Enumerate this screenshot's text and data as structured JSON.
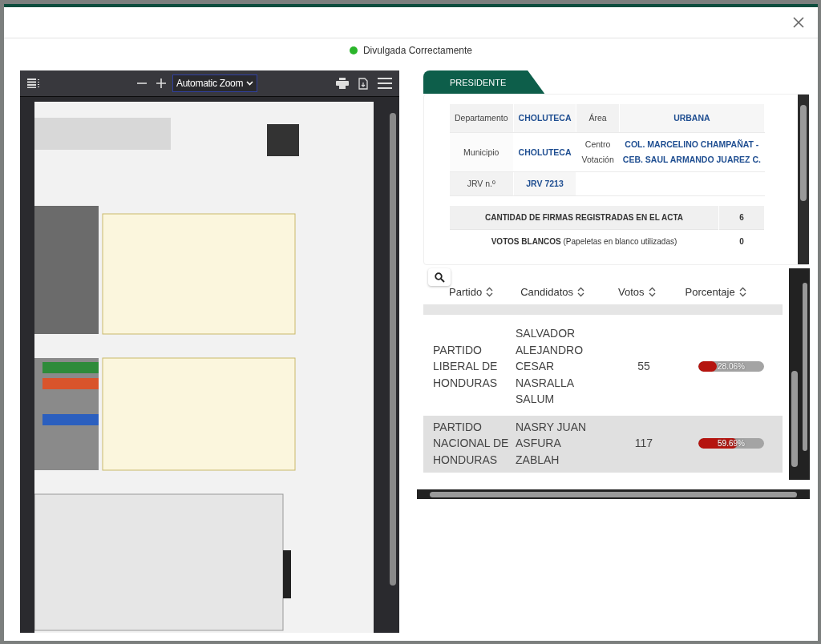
{
  "dialog": {
    "status": {
      "text": "Divulgada Correctamente",
      "color": "#2ab52a"
    }
  },
  "pdf_viewer": {
    "zoom": "Automatic Zoom"
  },
  "tabs": [
    {
      "label": "PRESIDENTE",
      "selected": true
    }
  ],
  "info_table": {
    "rows": [
      {
        "cells": [
          {
            "kind": "label",
            "text": "Departamento"
          },
          {
            "kind": "value",
            "text": "CHOLUTECA"
          },
          {
            "kind": "label",
            "text": "Área"
          },
          {
            "kind": "value",
            "text": "URBANA"
          }
        ]
      },
      {
        "cells": [
          {
            "kind": "label",
            "text": "Municipio"
          },
          {
            "kind": "value",
            "text": "CHOLUTECA"
          },
          {
            "kind": "label",
            "text": "Centro Votación"
          },
          {
            "kind": "value",
            "text": "COL. MARCELINO CHAMPAÑAT - CEB. SAUL ARMANDO JUAREZ C."
          }
        ]
      },
      {
        "cells": [
          {
            "kind": "label",
            "text": "JRV n.º"
          },
          {
            "kind": "value",
            "text": "JRV 7213"
          }
        ]
      }
    ]
  },
  "summary": [
    {
      "kind": "header",
      "label": "CANTIDAD DE FIRMAS REGISTRADAS EN EL ACTA",
      "value": "6"
    },
    {
      "kind": "row",
      "label": "**VOTOS BLANCOS** (Papeletas en blanco utilizadas)",
      "value": "0"
    }
  ],
  "results": {
    "columns": [
      "Partido",
      "Candidatos",
      "Votos",
      "Porcentaje"
    ],
    "rows": [
      {
        "party": "PARTIDO LIBERAL DE HONDURAS",
        "candidates": "SALVADOR ALEJANDRO CESAR NASRALLA SALUM",
        "votes": "55",
        "percent": "28.06%",
        "level": 0.2806,
        "selected": false
      },
      {
        "party": "PARTIDO NACIONAL DE HONDURAS",
        "candidates": "NASRY JUAN ASFURA ZABLAH",
        "votes": "117",
        "percent": "59.69%",
        "level": 0.5969,
        "selected": true
      }
    ]
  }
}
